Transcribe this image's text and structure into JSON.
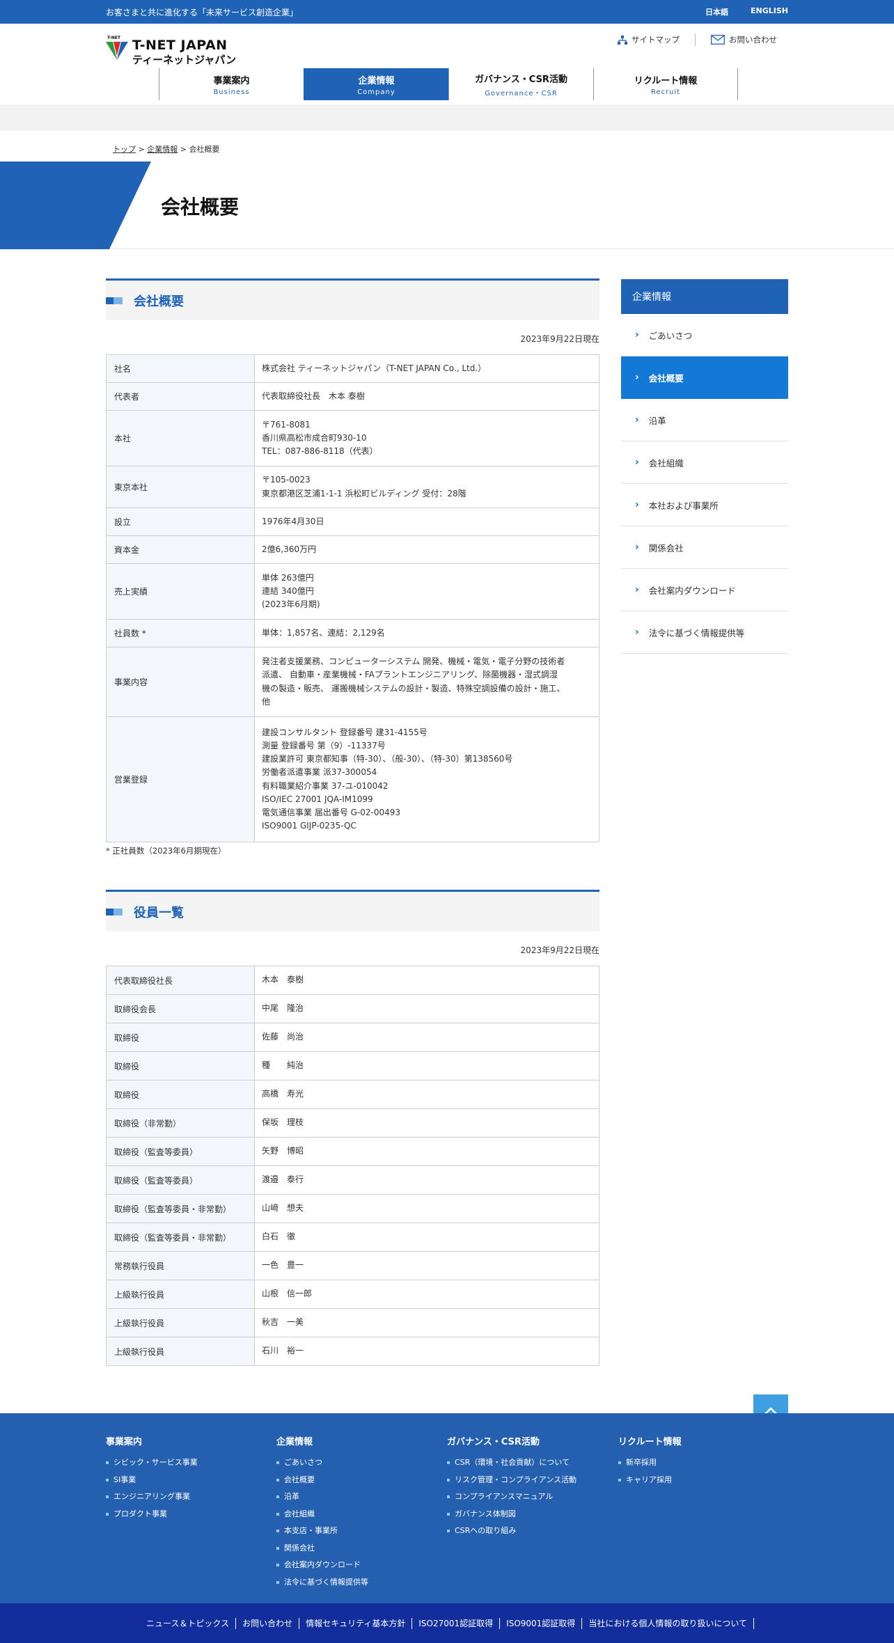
{
  "topbar": {
    "tagline": "お客さまと共に進化する「未来サービス創造企業」",
    "lang_ja": "日本語",
    "lang_en": "ENGLISH"
  },
  "logo": {
    "small": "T-NET",
    "en": "T-NET JAPAN",
    "ja": "ティーネットジャパン",
    "colors": [
      "#2a9b3a",
      "#e0262f",
      "#1f63b6"
    ]
  },
  "header": {
    "sitemap": "サイトマップ",
    "contact": "お問い合わせ"
  },
  "gnav": [
    {
      "ja": "事業案内",
      "en": "Business",
      "active": false
    },
    {
      "ja": "企業情報",
      "en": "Company",
      "active": true
    },
    {
      "ja": "ガバナンス・CSR活動",
      "en": "Governance・CSR",
      "active": false
    },
    {
      "ja": "リクルート情報",
      "en": "Recruit",
      "active": false
    }
  ],
  "breadcrumb": {
    "home": "トップ",
    "sep1": " > ",
    "company": "企業情報",
    "sep2": " > ",
    "current": "会社概要"
  },
  "page_title": "会社概要",
  "overview": {
    "heading": "会社概要",
    "asof": "2023年9月22日現在",
    "rows": [
      {
        "label": "社名",
        "lines": [
          "株式会社 ティーネットジャパン（T-NET JAPAN Co., Ltd.）"
        ]
      },
      {
        "label": "代表者",
        "lines": [
          "代表取締役社長　木本 泰樹"
        ]
      },
      {
        "label": "本社",
        "lines": [
          "〒761-8081",
          "香川県高松市成合町930-10",
          "TEL：087-886-8118（代表）"
        ]
      },
      {
        "label": "東京本社",
        "lines": [
          "〒105-0023",
          "東京都港区芝浦1-1-1 浜松町ビルディング 受付：28階"
        ]
      },
      {
        "label": "設立",
        "lines": [
          "1976年4月30日"
        ]
      },
      {
        "label": "資本金",
        "lines": [
          "2億6,360万円"
        ]
      },
      {
        "label": "売上実績",
        "lines": [
          "単体 263億円",
          "連結 340億円",
          "(2023年6月期)"
        ]
      },
      {
        "label": "社員数 *",
        "lines": [
          "単体：1,857名、連結：2,129名"
        ]
      },
      {
        "label": "事業内容",
        "lines": [
          "発注者支援業務、コンピューターシステム 開発、機械・電気・電子分野の技術者",
          "派遣、 自動車・産業機械・FAプラントエンジニアリング、除菌機器・湿式調湿",
          "機の製造・販売、 運搬機械システムの設計・製造、特殊空調設備の設計・施工、",
          "他"
        ]
      },
      {
        "label": "営業登録",
        "lines": [
          "建設コンサルタント 登録番号 建31-4155号",
          "測量 登録番号 第（9）-11337号",
          "建設業許可 東京都知事（特-30）、（般-30）、（特-30）第138560号",
          "労働者派遣事業 派37-300054",
          "有料職業紹介事業 37-ユ-010042",
          "ISO/IEC 27001  JQA-IM1099",
          "電気通信事業 届出番号 G-02-00493",
          "ISO9001  GIJP-0235-QC"
        ]
      }
    ],
    "note": "* 正社員数（2023年6月期現在）"
  },
  "officers": {
    "heading": "役員一覧",
    "asof": "2023年9月22日現在",
    "rows": [
      {
        "label": "代表取締役社長",
        "name": "木本　泰樹"
      },
      {
        "label": "取締役会長",
        "name": "中尾　隆治"
      },
      {
        "label": "取締役",
        "name": "佐藤　尚治"
      },
      {
        "label": "取締役",
        "name": "種　　純治"
      },
      {
        "label": "取締役",
        "name": "高橋　寿光"
      },
      {
        "label": "取締役（非常勤）",
        "name": "保坂　理枝"
      },
      {
        "label": "取締役（監査等委員）",
        "name": "矢野　博昭"
      },
      {
        "label": "取締役（監査等委員）",
        "name": "渡邉　泰行"
      },
      {
        "label": "取締役（監査等委員・非常勤）",
        "name": "山﨑　想夫"
      },
      {
        "label": "取締役（監査等委員・非常勤）",
        "name": "白石　徹"
      },
      {
        "label": "常務執行役員",
        "name": "一色　豊一"
      },
      {
        "label": "上級執行役員",
        "name": "山根　信一郎"
      },
      {
        "label": "上級執行役員",
        "name": "秋吉　一美"
      },
      {
        "label": "上級執行役員",
        "name": "石川　裕一"
      }
    ]
  },
  "sidebar": {
    "title": "企業情報",
    "items": [
      {
        "label": "ごあいさつ",
        "active": false
      },
      {
        "label": "会社概要",
        "active": true
      },
      {
        "label": "沿革",
        "active": false
      },
      {
        "label": "会社組織",
        "active": false
      },
      {
        "label": "本社および事業所",
        "active": false
      },
      {
        "label": "関係会社",
        "active": false
      },
      {
        "label": "会社案内ダウンロード",
        "active": false
      },
      {
        "label": "法令に基づく情報提供等",
        "active": false
      }
    ]
  },
  "footer": {
    "columns": [
      {
        "heading": "事業案内",
        "links": [
          "シビック・サービス事業",
          "SI事業",
          "エンジニアリング事業",
          "プロダクト事業"
        ]
      },
      {
        "heading": "企業情報",
        "links": [
          "ごあいさつ",
          "会社概要",
          "沿革",
          "会社組織",
          "本支店・事業所",
          "関係会社",
          "会社案内ダウンロード",
          "法令に基づく情報提供等"
        ]
      },
      {
        "heading": "ガバナンス・CSR活動",
        "links": [
          "CSR（環境・社会貢献）について",
          "リスク管理・コンプライアンス活動",
          "コンプライアンスマニュアル",
          "ガバナンス体制図",
          "CSRへの取り組み"
        ]
      },
      {
        "heading": "リクルート情報",
        "links": [
          "新卒採用",
          "キャリア採用"
        ]
      }
    ],
    "bottom_links": [
      "ニュース＆トピックス",
      "お問い合わせ",
      "情報セキュリティ基本方針",
      "ISO27001認証取得",
      "ISO9001認証取得",
      "当社における個人情報の取り扱いについて"
    ]
  }
}
